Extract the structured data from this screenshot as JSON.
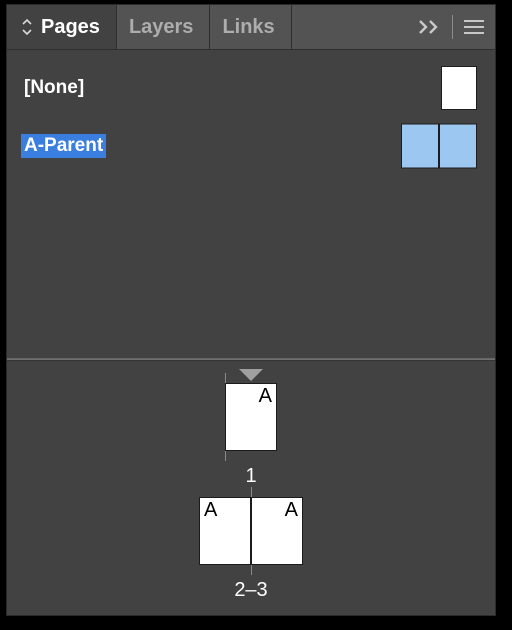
{
  "tabs": {
    "pages": "Pages",
    "layers": "Layers",
    "links": "Links"
  },
  "masters": {
    "none": {
      "label": "[None]"
    },
    "aparent": {
      "label": "A-Parent"
    }
  },
  "docpages": {
    "page1": {
      "prefix": "A",
      "label": "1"
    },
    "spread23": {
      "prefixLeft": "A",
      "prefixRight": "A",
      "label": "2–3"
    }
  }
}
